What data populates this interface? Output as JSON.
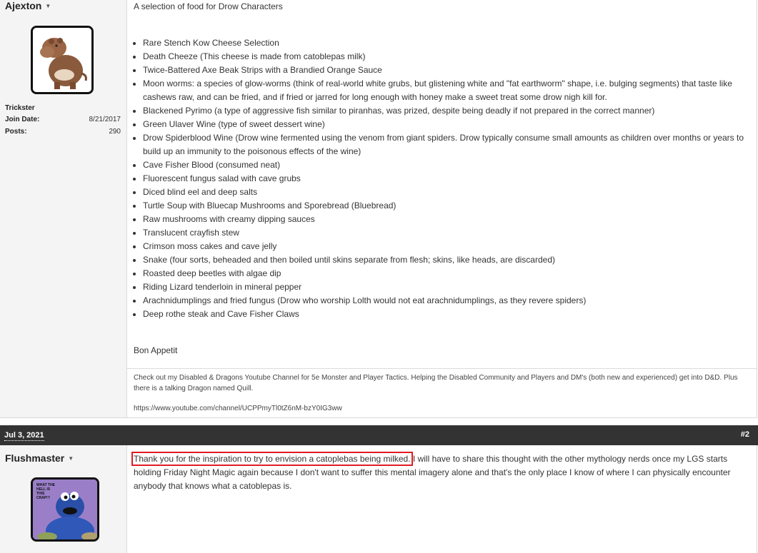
{
  "post1": {
    "username": "Ajexton",
    "user_title": "Trickster",
    "join_date_label": "Join Date:",
    "join_date": "8/21/2017",
    "posts_label": "Posts:",
    "posts_count": "290",
    "intro": "A selection of food for Drow Characters",
    "items": [
      "Rare Stench Kow Cheese Selection",
      "Death Cheeze (This cheese is made from catoblepas milk)",
      "Twice-Battered Axe Beak Strips with a Brandied Orange Sauce",
      "Moon worms: a species of glow-worms (think of real-world white grubs, but glistening white and \"fat earthworm\" shape, i.e. bulging segments) that taste like cashews raw, and can be fried, and if fried or jarred for long enough with honey make a sweet treat some drow nigh kill for.",
      "Blackened Pyrimo (a type of aggressive fish similar to piranhas, was prized, despite being deadly if not prepared in the correct manner)",
      "Green Ulaver Wine (type of sweet dessert wine)",
      "Drow Spiderblood Wine (Drow wine fermented using the venom from giant spiders. Drow typically consume small amounts as children over months or years to build up an immunity to the poisonous effects of the wine)",
      "Cave Fisher Blood (consumed neat)",
      "Fluorescent fungus salad with cave grubs",
      "Diced blind eel and deep salts",
      "Turtle Soup with Bluecap Mushrooms and Sporebread (Bluebread)",
      "Raw mushrooms with creamy dipping sauces",
      "Translucent crayfish stew",
      "Crimson moss cakes and cave jelly",
      "Snake (four sorts, beheaded and then boiled until skins separate from flesh; skins, like heads, are discarded)",
      "Roasted deep beetles with algae dip",
      "Riding Lizard tenderloin in mineral pepper",
      "Arachnidumplings and fried fungus (Drow who worship Lolth would not eat arachnidumplings, as they revere spiders)",
      "Deep rothe steak and Cave Fisher Claws"
    ],
    "closing": "Bon Appetit",
    "signature": "Check out my Disabled & Dragons Youtube Channel for 5e Monster and Player Tactics. Helping the Disabled Community and Players and DM's (both new and experienced) get into D&D. Plus there is a talking Dragon named Quill.",
    "signature_url": "https://www.youtube.com/channel/UCPPmyTl0tZ6nM-bzY0IG3ww"
  },
  "bar": {
    "date": "Jul 3, 2021",
    "post_number": "#2"
  },
  "post2": {
    "username": "Flushmaster",
    "avatar_caption": "WHAT THE HELL IS THIS CRAP!?",
    "highlighted_text": "Thank you for the inspiration to try to envision a catoplebas being milked.",
    "body_rest": " I will have to share this thought with the other mythology nerds once my LGS starts holding Friday Night Magic again because I don't want to suffer this mental imagery alone and that's the only place I know of where I can physically encounter anybody that knows what a catoblepas is."
  },
  "colors": {
    "highlight": "#e01b24",
    "bar_bg": "#333333",
    "sidebar_bg": "#f4f4f4"
  }
}
